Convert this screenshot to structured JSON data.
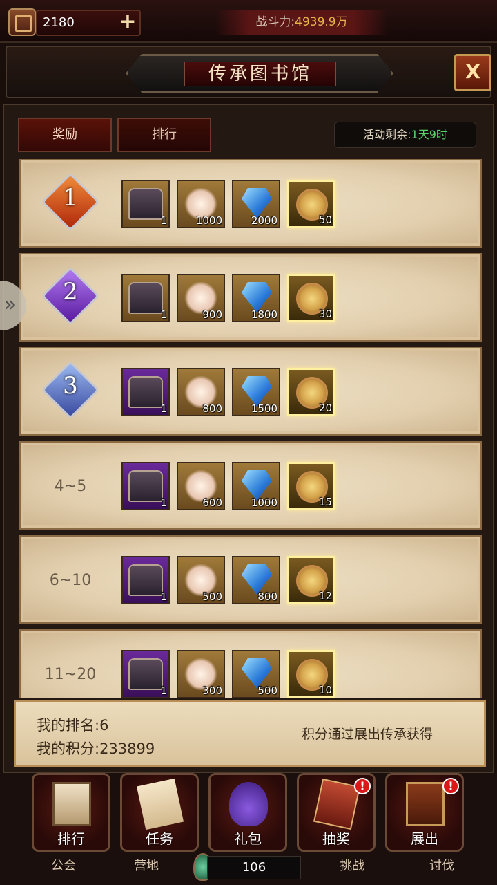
{
  "topbar": {
    "currency_value": "2180",
    "plus_label": "+",
    "power_label": "战斗力:",
    "power_value": "4939.9万"
  },
  "title": "传承图书馆",
  "close_label": "X",
  "tabs": [
    {
      "label": "奖励"
    },
    {
      "label": "排行"
    }
  ],
  "remaining": {
    "label": "活动剩余:",
    "value": "1天9时"
  },
  "tiers": [
    {
      "rank": "1",
      "chest": "1",
      "dust": "1000",
      "gem": "2000",
      "coin": "50"
    },
    {
      "rank": "2",
      "chest": "1",
      "dust": "900",
      "gem": "1800",
      "coin": "30"
    },
    {
      "rank": "3",
      "chest": "1",
      "dust": "800",
      "gem": "1500",
      "coin": "20"
    },
    {
      "rank": "4~5",
      "chest": "1",
      "dust": "600",
      "gem": "1000",
      "coin": "15"
    },
    {
      "rank": "6~10",
      "chest": "1",
      "dust": "500",
      "gem": "800",
      "coin": "12"
    },
    {
      "rank": "11~20",
      "chest": "1",
      "dust": "300",
      "gem": "500",
      "coin": "10"
    }
  ],
  "my_info": {
    "rank": "我的排名:6",
    "score": "我的积分:233899",
    "hint": "积分通过展出传承获得"
  },
  "nav": [
    {
      "label": "排行"
    },
    {
      "label": "任务"
    },
    {
      "label": "礼包"
    },
    {
      "label": "抽奖"
    },
    {
      "label": "展出"
    }
  ],
  "alerts": {
    "draw": "!",
    "show": "!"
  },
  "under_nav": {
    "guild": "公会",
    "camp": "营地",
    "stamina": "106",
    "challenge": "挑战",
    "crusade": "讨伐"
  },
  "side_arrow": "»"
}
